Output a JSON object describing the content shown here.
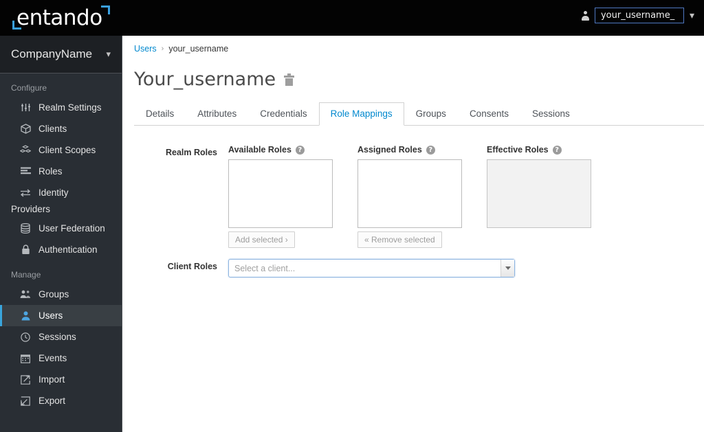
{
  "topbar": {
    "logo_text": "entando",
    "user_icon": "person-icon",
    "username": "your_username_",
    "dropdown_chevron": "chevron-down-icon"
  },
  "sidebar": {
    "company": {
      "name": "CompanyName",
      "chevron": "chevron-down-icon"
    },
    "sections": [
      {
        "title": "Configure",
        "items": [
          {
            "label": "Realm Settings",
            "icon": "sliders-icon",
            "active": false
          },
          {
            "label": "Clients",
            "icon": "cube-icon",
            "active": false
          },
          {
            "label": "Client Scopes",
            "icon": "cubes-icon",
            "active": false
          },
          {
            "label": "Roles",
            "icon": "list-icon",
            "active": false
          },
          {
            "label": "Identity",
            "icon": "exchange-icon",
            "active": false
          }
        ],
        "wrapped_label": "Providers"
      },
      {
        "title": "",
        "items": [
          {
            "label": "User Federation",
            "icon": "database-icon",
            "active": false
          },
          {
            "label": "Authentication",
            "icon": "lock-icon",
            "active": false
          }
        ]
      },
      {
        "title": "Manage",
        "items": [
          {
            "label": "Groups",
            "icon": "users-icon",
            "active": false
          },
          {
            "label": "Users",
            "icon": "user-icon",
            "active": true
          },
          {
            "label": "Sessions",
            "icon": "clock-icon",
            "active": false
          },
          {
            "label": "Events",
            "icon": "calendar-icon",
            "active": false
          },
          {
            "label": "Import",
            "icon": "import-icon",
            "active": false
          },
          {
            "label": "Export",
            "icon": "export-icon",
            "active": false
          }
        ]
      }
    ]
  },
  "main": {
    "breadcrumb": {
      "parent": "Users",
      "separator": "›",
      "current": "your_username"
    },
    "page_title": "Your_username",
    "delete_icon": "trash-icon",
    "tabs": [
      {
        "label": "Details",
        "active": false
      },
      {
        "label": "Attributes",
        "active": false
      },
      {
        "label": "Credentials",
        "active": false
      },
      {
        "label": "Role Mappings",
        "active": true
      },
      {
        "label": "Groups",
        "active": false
      },
      {
        "label": "Consents",
        "active": false
      },
      {
        "label": "Sessions",
        "active": false
      }
    ],
    "realm_roles": {
      "label": "Realm Roles",
      "available": {
        "header": "Available Roles",
        "help": "?",
        "items": []
      },
      "assigned": {
        "header": "Assigned Roles",
        "help": "?",
        "items": []
      },
      "effective": {
        "header": "Effective Roles",
        "help": "?",
        "items": [],
        "disabled": true
      },
      "add_button": "Add selected ›",
      "remove_button": "« Remove selected"
    },
    "client_roles": {
      "label": "Client Roles",
      "select_placeholder": "Select a client...",
      "select_value": "",
      "arrow_icon": "caret-down-icon"
    }
  },
  "colors": {
    "accent_blue": "#0088ce",
    "sidebar_bg": "#292e34",
    "sidebar_active_bg": "#393f44",
    "active_bar": "#39a5dc",
    "topbar_bg": "#030303",
    "logo_bracket": "#3aa0e0"
  }
}
